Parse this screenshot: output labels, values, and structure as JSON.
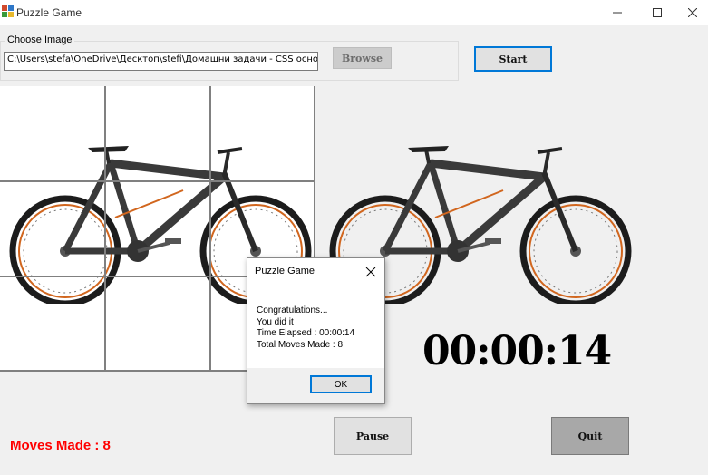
{
  "window": {
    "title": "Puzzle Game"
  },
  "image_group": {
    "label": "Choose Image",
    "path_value": "C:\\Users\\stefa\\OneDrive\\Десктоп\\stefi\\Домашни задачи - CSS основи\\s",
    "browse_label": "Browse"
  },
  "controls": {
    "start_label": "Start",
    "pause_label": "Pause",
    "quit_label": "Quit"
  },
  "timer": {
    "value": "00:00:14"
  },
  "moves": {
    "text": "Moves Made : 8"
  },
  "dialog": {
    "title": "Puzzle Game",
    "lines": [
      "Congratulations...",
      "You did it",
      "Time Elapsed : 00:00:14",
      "Total Moves Made : 8"
    ],
    "ok_label": "OK"
  },
  "colors": {
    "accent": "#0078d7",
    "moves_text": "#ff0000"
  }
}
